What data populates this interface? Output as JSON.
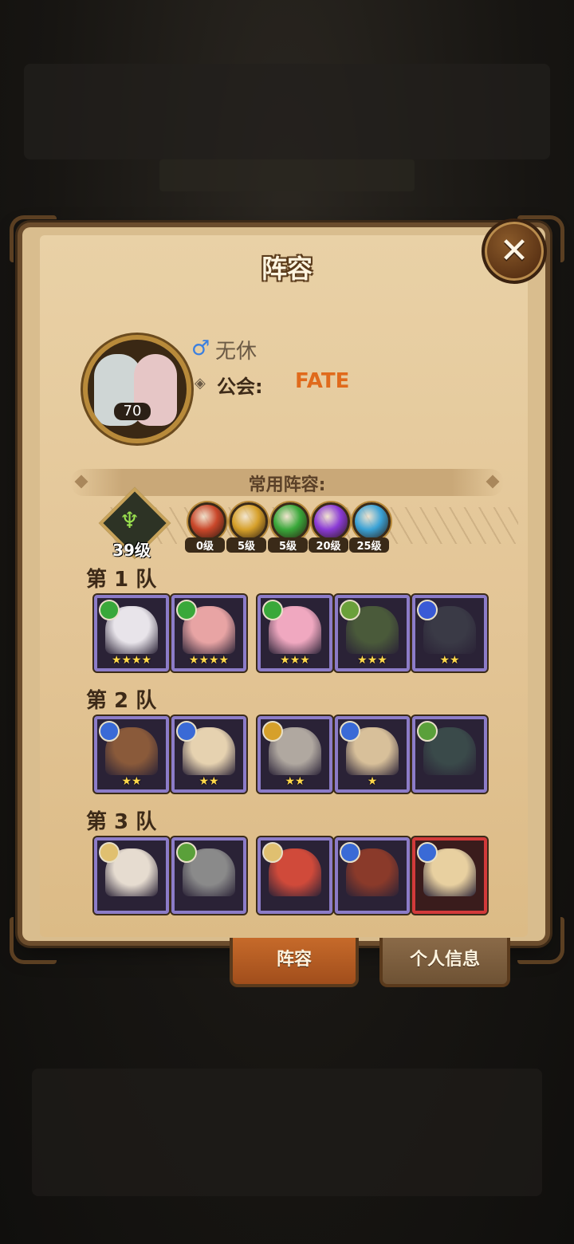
{
  "dialog": {
    "title": "阵容",
    "close_icon": "close-icon"
  },
  "profile": {
    "avatar_level": "70",
    "gender_icon": "male-icon",
    "name": "无休",
    "guild_label": "公会:",
    "guild_value": "FATE"
  },
  "lineup_header": "常用阵容:",
  "resonance": {
    "tree_level": "39级",
    "factions": [
      {
        "name": "faction-lightbearer-icon",
        "level": "0级",
        "color": "#c9472a"
      },
      {
        "name": "faction-mauler-icon",
        "level": "5级",
        "color": "#d6a02a"
      },
      {
        "name": "faction-wilder-icon",
        "level": "5级",
        "color": "#39a83a"
      },
      {
        "name": "faction-graveborn-icon",
        "level": "20级",
        "color": "#8a3ad6"
      },
      {
        "name": "faction-celestial-icon",
        "level": "25级",
        "color": "#3aa2d6"
      }
    ]
  },
  "teams": [
    {
      "label": "第 1 队",
      "heroes": [
        {
          "stars": "★★★★",
          "emblem": "#39a83a",
          "tone": "#e8e4ea"
        },
        {
          "stars": "★★★★",
          "emblem": "#39a83a",
          "tone": "#e8a4a4"
        },
        {
          "stars": "★★★",
          "emblem": "#39a83a",
          "tone": "#f0a8c0"
        },
        {
          "stars": "★★★",
          "emblem": "#6aa03a",
          "tone": "#4a5a3a"
        },
        {
          "stars": "★★",
          "emblem": "#3a5ad6",
          "tone": "#3a3a46"
        }
      ]
    },
    {
      "label": "第 2 队",
      "heroes": [
        {
          "stars": "★★",
          "emblem": "#3a6ad6",
          "tone": "#8a5a3a"
        },
        {
          "stars": "★★",
          "emblem": "#3a6ad6",
          "tone": "#e6d2b0"
        },
        {
          "stars": "★★",
          "emblem": "#d6a02a",
          "tone": "#b0a8a0"
        },
        {
          "stars": "★",
          "emblem": "#3a6ad6",
          "tone": "#d8c09a"
        },
        {
          "stars": "",
          "emblem": "#5aa03a",
          "tone": "#3a4a4a"
        }
      ]
    },
    {
      "label": "第 3 队",
      "heroes": [
        {
          "stars": "",
          "emblem": "#e0c070",
          "tone": "#e6dcd0"
        },
        {
          "stars": "",
          "emblem": "#5aa03a",
          "tone": "#8a8a8a"
        },
        {
          "stars": "",
          "emblem": "#e0c070",
          "tone": "#d04a3a"
        },
        {
          "stars": "",
          "emblem": "#3a6ad6",
          "tone": "#8a3a2a"
        },
        {
          "stars": "",
          "emblem": "#3a6ad6",
          "tone": "#e8d0a0",
          "frame": "red"
        }
      ]
    }
  ],
  "tabs": {
    "lineup": "阵容",
    "personal_info": "个人信息"
  }
}
